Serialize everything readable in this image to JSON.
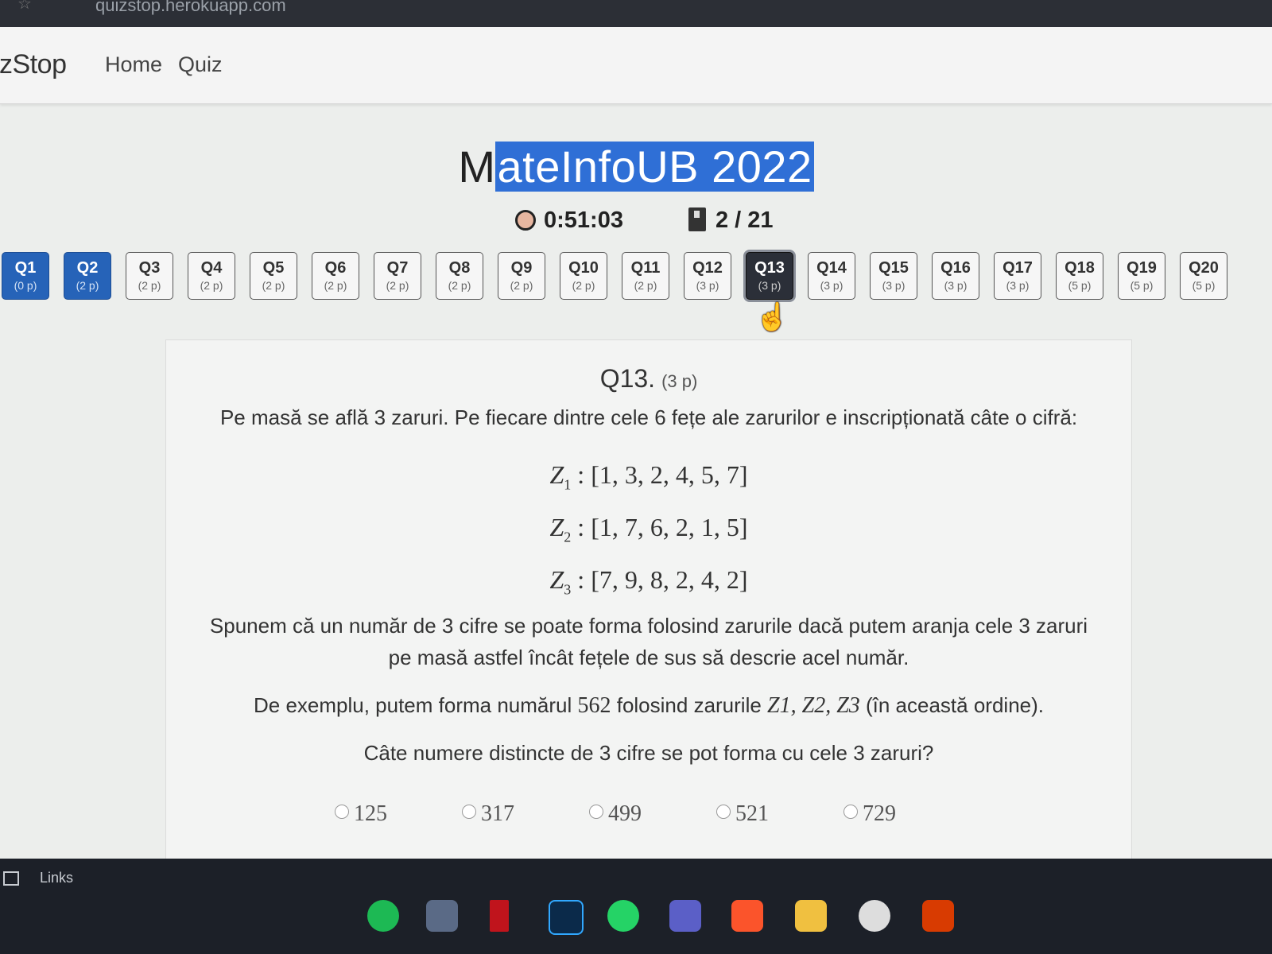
{
  "browser": {
    "url": "quizstop.herokuapp.com"
  },
  "navbar": {
    "brand": "izStop",
    "links": [
      "Home",
      "Quiz"
    ]
  },
  "quiz": {
    "title_plain": "M",
    "title_selected": "ateInfoUB 2022",
    "timer": "0:51:03",
    "progress": "2 / 21"
  },
  "questions_nav": [
    {
      "label": "Q1",
      "points": "(0 p)",
      "state": "answered"
    },
    {
      "label": "Q2",
      "points": "(2 p)",
      "state": "answered"
    },
    {
      "label": "Q3",
      "points": "(2 p)",
      "state": "default"
    },
    {
      "label": "Q4",
      "points": "(2 p)",
      "state": "default"
    },
    {
      "label": "Q5",
      "points": "(2 p)",
      "state": "default"
    },
    {
      "label": "Q6",
      "points": "(2 p)",
      "state": "default"
    },
    {
      "label": "Q7",
      "points": "(2 p)",
      "state": "default"
    },
    {
      "label": "Q8",
      "points": "(2 p)",
      "state": "default"
    },
    {
      "label": "Q9",
      "points": "(2 p)",
      "state": "default"
    },
    {
      "label": "Q10",
      "points": "(2 p)",
      "state": "default"
    },
    {
      "label": "Q11",
      "points": "(2 p)",
      "state": "default"
    },
    {
      "label": "Q12",
      "points": "(3 p)",
      "state": "default"
    },
    {
      "label": "Q13",
      "points": "(3 p)",
      "state": "current"
    },
    {
      "label": "Q14",
      "points": "(3 p)",
      "state": "default"
    },
    {
      "label": "Q15",
      "points": "(3 p)",
      "state": "default"
    },
    {
      "label": "Q16",
      "points": "(3 p)",
      "state": "default"
    },
    {
      "label": "Q17",
      "points": "(3 p)",
      "state": "default"
    },
    {
      "label": "Q18",
      "points": "(5 p)",
      "state": "default"
    },
    {
      "label": "Q19",
      "points": "(5 p)",
      "state": "default"
    },
    {
      "label": "Q20",
      "points": "(5 p)",
      "state": "default"
    }
  ],
  "question": {
    "number": "Q13.",
    "points": "(3 p)",
    "intro": "Pe masă se află 3 zaruri. Pe fiecare dintre cele 6 fețe ale zarurilor e inscripționată câte o cifră:",
    "dice": [
      {
        "name": "Z",
        "sub": "1",
        "faces": ": [1, 3, 2, 4, 5, 7]"
      },
      {
        "name": "Z",
        "sub": "2",
        "faces": ": [1, 7, 6, 2, 1, 5]"
      },
      {
        "name": "Z",
        "sub": "3",
        "faces": ": [7, 9, 8, 2, 4, 2]"
      }
    ],
    "rule_line1": "Spunem că un număr de 3 cifre se poate forma folosind zarurile dacă putem aranja cele 3 zaruri",
    "rule_line2": "pe masă astfel încât fețele de sus să descrie acel număr.",
    "example_start": "De exemplu, putem forma numărul ",
    "example_number": "562",
    "example_mid": " folosind zarurile ",
    "example_dice": "Z1, Z2, Z3",
    "example_end": " (în această ordine).",
    "ask": "Câte numere distincte de 3 cifre se pot forma cu cele 3 zaruri?",
    "options": [
      "125",
      "317",
      "499",
      "521",
      "729"
    ]
  },
  "taskbar": {
    "links_label": "Links"
  },
  "colors": {
    "answered": "#2663b8",
    "current": "#2b2f38",
    "selection": "#2f6fd6"
  },
  "icons": [
    "star-icon",
    "alarm-clock-icon",
    "book-icon",
    "hand-cursor-icon",
    "spotify-icon",
    "store-icon",
    "netflix-icon",
    "photoshop-icon",
    "whatsapp-icon",
    "teams-icon",
    "brave-icon",
    "file-explorer-icon",
    "chrome-icon",
    "office-icon"
  ]
}
